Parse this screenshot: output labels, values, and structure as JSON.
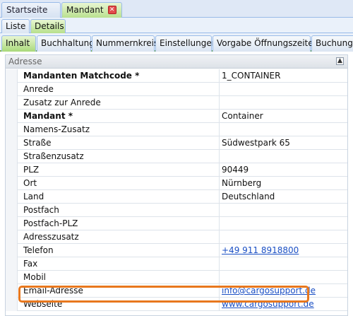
{
  "doc_tabs": [
    {
      "label": "Startseite",
      "active": false
    },
    {
      "label": "Mandant",
      "active": true,
      "close_glyph": "✕"
    }
  ],
  "sub_tabs": [
    {
      "label": "Liste",
      "active": false
    },
    {
      "label": "Details",
      "active": true
    }
  ],
  "section_tabs": [
    {
      "label": "Inhalt",
      "active": true
    },
    {
      "label": "Buchhaltung",
      "active": false
    },
    {
      "label": "Nummernkreise",
      "active": false
    },
    {
      "label": "Einstellungen",
      "active": false
    },
    {
      "label": "Vorgabe Öffnungszeiten",
      "active": false
    },
    {
      "label": "Buchungs",
      "active": false
    }
  ],
  "group": {
    "title": "Adresse",
    "collapse_glyph": "▲"
  },
  "rows": [
    {
      "label": "Mandanten Matchcode *",
      "value": "1_CONTAINER"
    },
    {
      "label": "Anrede",
      "value": ""
    },
    {
      "label": "Zusatz zur Anrede",
      "value": ""
    },
    {
      "label": "Mandant *",
      "value": "Container"
    },
    {
      "label": "Namens-Zusatz",
      "value": ""
    },
    {
      "label": "Straße",
      "value": "Südwestpark 65"
    },
    {
      "label": "Straßenzusatz",
      "value": ""
    },
    {
      "label": "PLZ",
      "value": "90449"
    },
    {
      "label": "Ort",
      "value": "Nürnberg"
    },
    {
      "label": "Land",
      "value": "Deutschland"
    },
    {
      "label": "Postfach",
      "value": ""
    },
    {
      "label": "Postfach-PLZ",
      "value": ""
    },
    {
      "label": "Adresszusatz",
      "value": ""
    },
    {
      "label": "Telefon",
      "value": "+49 911 8918800"
    },
    {
      "label": "Fax",
      "value": ""
    },
    {
      "label": "Mobil",
      "value": ""
    },
    {
      "label": "Email-Adresse",
      "value": "info@cargosupport.de"
    },
    {
      "label": "Webseite",
      "value": "www.cargosupport.de"
    }
  ],
  "colors": {
    "highlight": "#e8781e",
    "link": "#1a4fc4",
    "active_tab": "#b7e08c"
  }
}
